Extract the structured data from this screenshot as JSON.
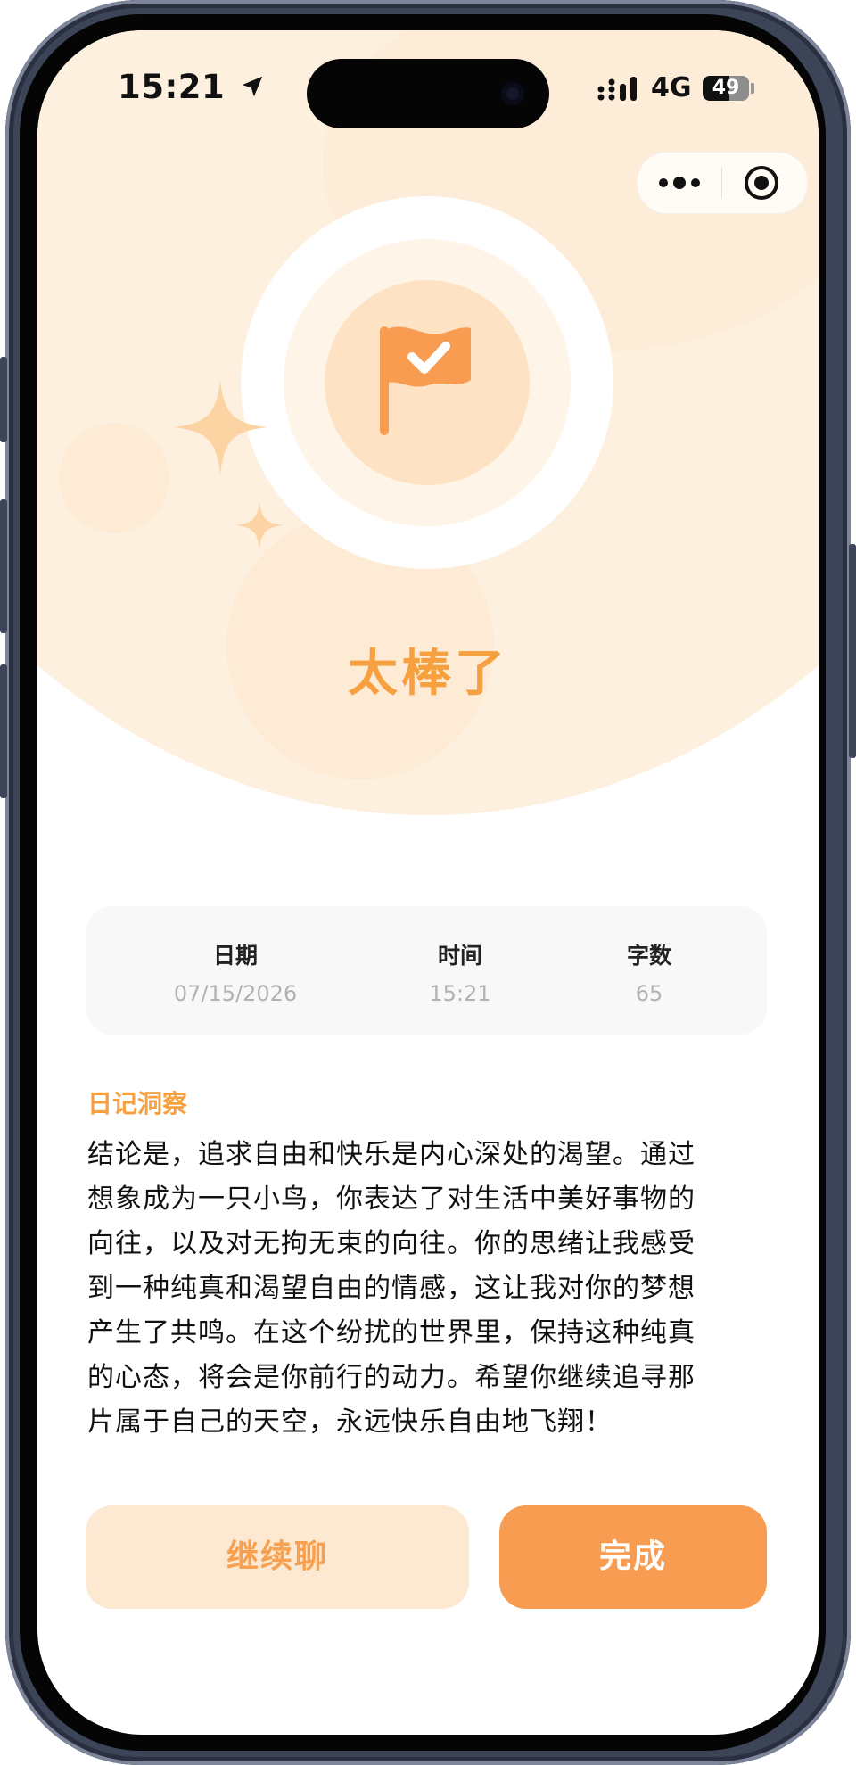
{
  "status_bar": {
    "time": "15:21",
    "network": "4G",
    "battery": "49"
  },
  "colors": {
    "accent": "#f7a03f",
    "button_primary": "#f79c50",
    "button_secondary_bg": "#fde8d2",
    "hero_bg": "#fef0df"
  },
  "badge": {
    "icon": "flag-check-icon"
  },
  "headline": "太棒了",
  "stats": [
    {
      "label": "日期",
      "value": "07/15/2026"
    },
    {
      "label": "时间",
      "value": "15:21"
    },
    {
      "label": "字数",
      "value": "65"
    }
  ],
  "insight": {
    "title": "日记洞察",
    "lines": [
      "结论是，追求自由和快乐是内心深处的渴望。通过",
      "想象成为一只小鸟，你表达了对生活中美好事物的",
      "向往，以及对无拘无束的向往。你的思绪让我感受",
      "到一种纯真和渴望自由的情感，这让我对你的梦想",
      "产生了共鸣。在这个纷扰的世界里，保持这种纯真",
      "的心态，将会是你前行的动力。希望你继续追寻那",
      "片属于自己的天空，永远快乐自由地飞翔！"
    ]
  },
  "buttons": {
    "continue": "继续聊",
    "done": "完成"
  }
}
